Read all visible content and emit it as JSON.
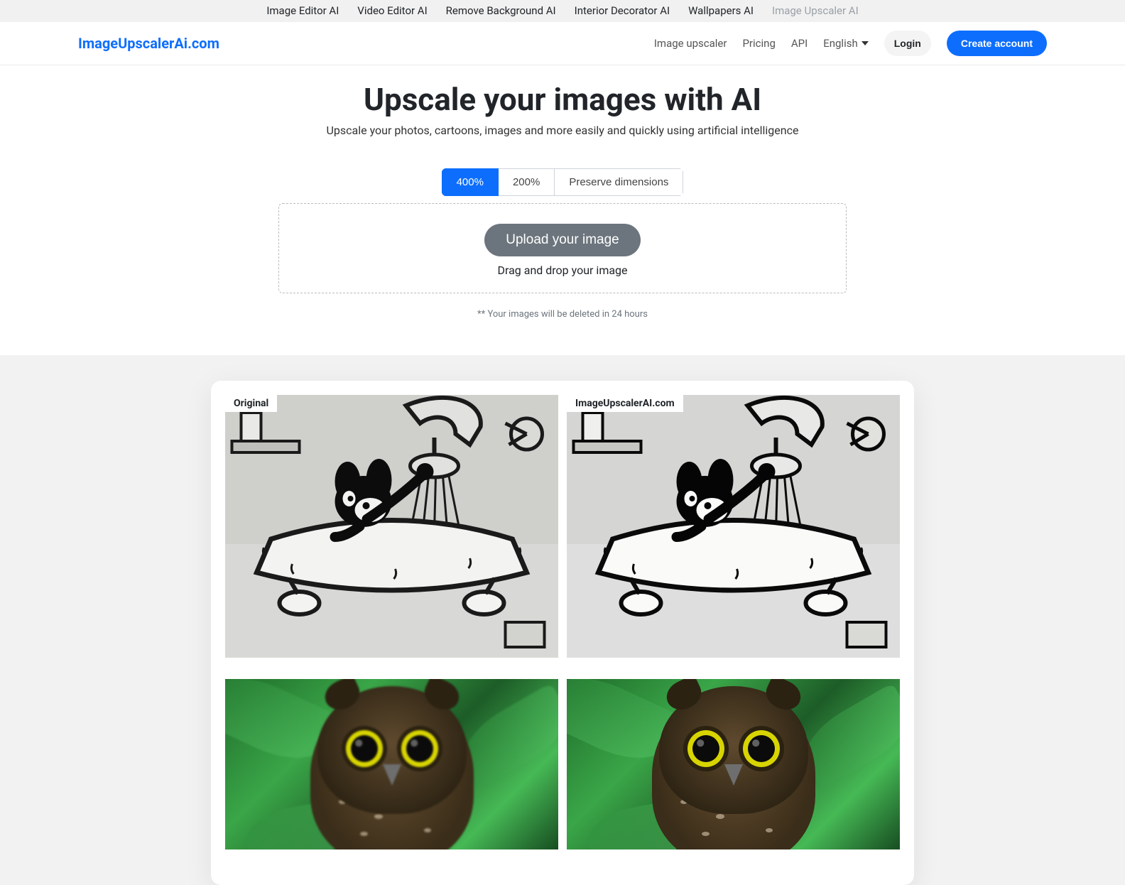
{
  "topbar": {
    "links": [
      "Image Editor AI",
      "Video Editor AI",
      "Remove Background AI",
      "Interior Decorator AI",
      "Wallpapers AI",
      "Image Upscaler AI"
    ],
    "current_index": 5
  },
  "navbar": {
    "brand": "ImageUpscalerAi.com",
    "links": [
      "Image upscaler",
      "Pricing",
      "API"
    ],
    "language": "English",
    "login": "Login",
    "create_account": "Create account"
  },
  "hero": {
    "title": "Upscale your images with AI",
    "subtitle": "Upscale your photos, cartoons, images and more easily and quickly using artificial intelligence"
  },
  "scale_options": {
    "options": [
      "400%",
      "200%",
      "Preserve dimensions"
    ],
    "active_index": 0
  },
  "dropzone": {
    "button": "Upload your image",
    "text": "Drag and drop your image"
  },
  "disclaimer": "** Your images will be deleted in 24 hours",
  "examples": {
    "original_label": "Original",
    "upscaled_label": "ImageUpscalerAI.com"
  }
}
